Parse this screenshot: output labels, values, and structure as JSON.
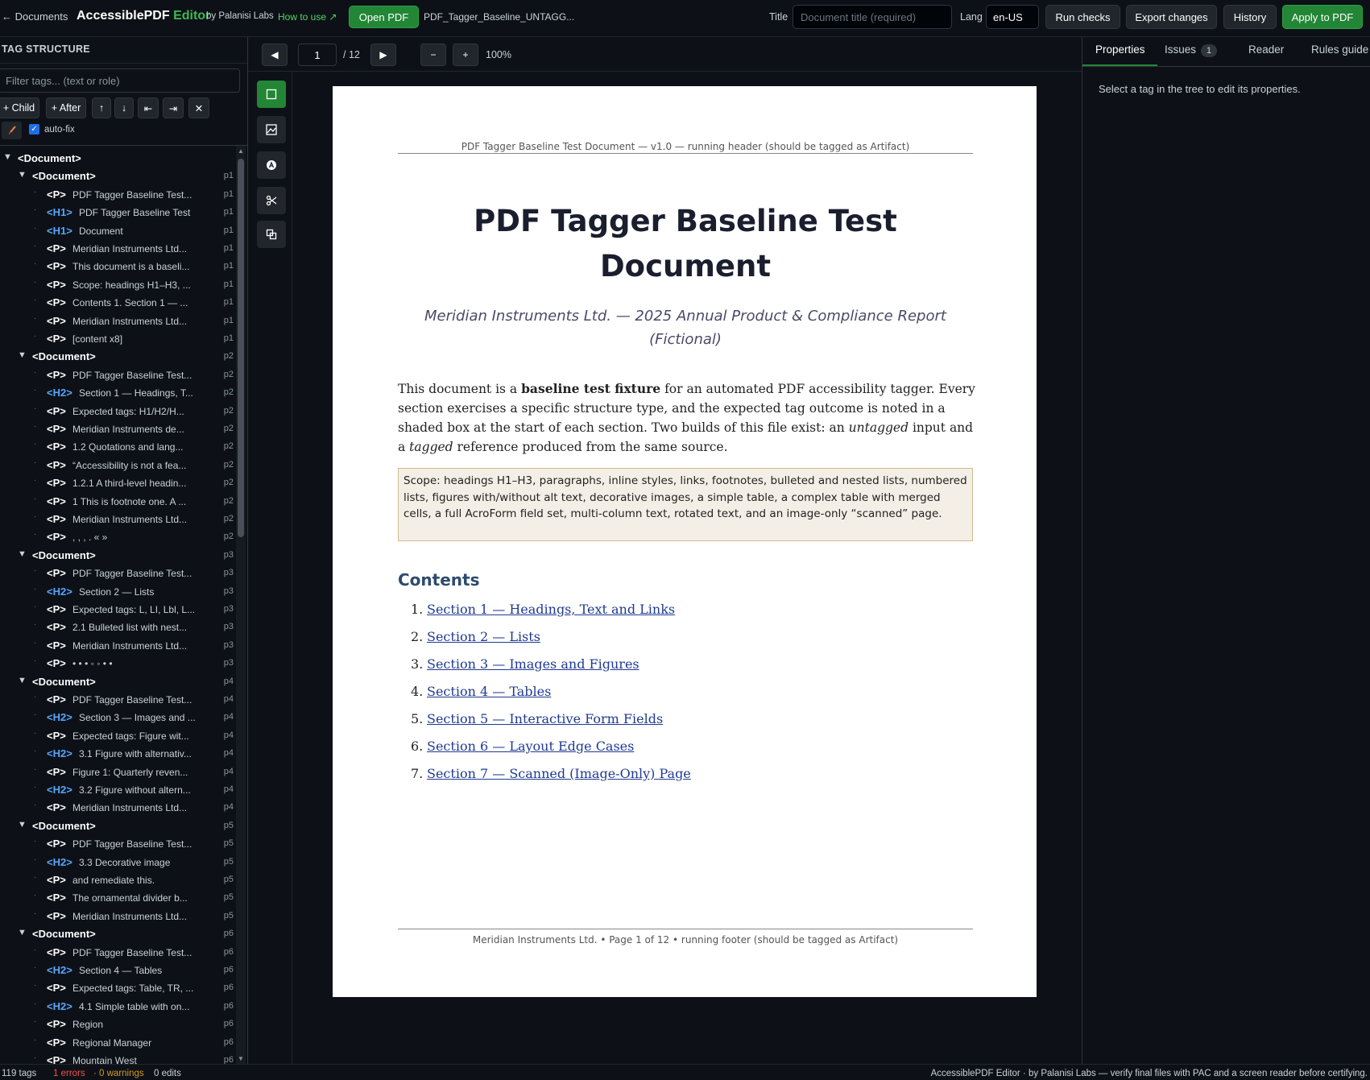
{
  "topbar": {
    "back_label": "← Documents",
    "brand_main": "AccessiblePDF ",
    "brand_accent": "Editor",
    "byline": "by Palanisi Labs",
    "howto": "How to use ↗",
    "open_pdf": "Open PDF",
    "filename": "PDF_Tagger_Baseline_UNTAGG...",
    "title_label": "Title",
    "title_placeholder": "Document title (required)",
    "lang_label": "Lang",
    "lang_value": "en-US",
    "run_checks": "Run checks",
    "export_changes": "Export changes",
    "history": "History",
    "apply": "Apply to PDF"
  },
  "left": {
    "title": "TAG STRUCTURE",
    "filter_placeholder": "Filter tags... (text or role)",
    "add_child": "+ Child",
    "add_after": "+ After",
    "move_up": "↑",
    "move_down": "↓",
    "outdent": "⇤",
    "indent": "⇥",
    "delete": "✕",
    "autofix": "auto-fix",
    "tree": [
      {
        "d": 0,
        "tag": "<Document>",
        "label": "",
        "page": "",
        "kind": "doc"
      },
      {
        "d": 1,
        "tag": "<Document>",
        "label": "",
        "page": "p1",
        "kind": "doc"
      },
      {
        "d": 2,
        "tag": "<P>",
        "label": "PDF Tagger Baseline Test...",
        "page": "p1",
        "kind": "p"
      },
      {
        "d": 2,
        "tag": "<H1>",
        "label": "PDF Tagger Baseline Test",
        "page": "p1",
        "kind": "h"
      },
      {
        "d": 2,
        "tag": "<H1>",
        "label": "Document",
        "page": "p1",
        "kind": "h"
      },
      {
        "d": 2,
        "tag": "<P>",
        "label": "Meridian Instruments Ltd...",
        "page": "p1",
        "kind": "p"
      },
      {
        "d": 2,
        "tag": "<P>",
        "label": "This document is a baseli...",
        "page": "p1",
        "kind": "p"
      },
      {
        "d": 2,
        "tag": "<P>",
        "label": "Scope: headings H1–H3, ...",
        "page": "p1",
        "kind": "p"
      },
      {
        "d": 2,
        "tag": "<P>",
        "label": "Contents 1. Section 1 — ...",
        "page": "p1",
        "kind": "p"
      },
      {
        "d": 2,
        "tag": "<P>",
        "label": "Meridian Instruments Ltd...",
        "page": "p1",
        "kind": "p"
      },
      {
        "d": 2,
        "tag": "<P>",
        "label": "[content x8]",
        "page": "p1",
        "kind": "p"
      },
      {
        "d": 1,
        "tag": "<Document>",
        "label": "",
        "page": "p2",
        "kind": "doc"
      },
      {
        "d": 2,
        "tag": "<P>",
        "label": "PDF Tagger Baseline Test...",
        "page": "p2",
        "kind": "p"
      },
      {
        "d": 2,
        "tag": "<H2>",
        "label": "Section 1 — Headings, T...",
        "page": "p2",
        "kind": "h"
      },
      {
        "d": 2,
        "tag": "<P>",
        "label": "Expected tags: H1/H2/H...",
        "page": "p2",
        "kind": "p"
      },
      {
        "d": 2,
        "tag": "<P>",
        "label": "Meridian Instruments de...",
        "page": "p2",
        "kind": "p"
      },
      {
        "d": 2,
        "tag": "<P>",
        "label": "1.2 Quotations and lang...",
        "page": "p2",
        "kind": "p"
      },
      {
        "d": 2,
        "tag": "<P>",
        "label": "“Accessibility is not a fea...",
        "page": "p2",
        "kind": "p"
      },
      {
        "d": 2,
        "tag": "<P>",
        "label": "1.2.1 A third-level headin...",
        "page": "p2",
        "kind": "p"
      },
      {
        "d": 2,
        "tag": "<P>",
        "label": "1 This is footnote one. A ...",
        "page": "p2",
        "kind": "p"
      },
      {
        "d": 2,
        "tag": "<P>",
        "label": "Meridian Instruments Ltd...",
        "page": "p2",
        "kind": "p"
      },
      {
        "d": 2,
        "tag": "<P>",
        "label": ", , , . « »",
        "page": "p2",
        "kind": "p"
      },
      {
        "d": 1,
        "tag": "<Document>",
        "label": "",
        "page": "p3",
        "kind": "doc"
      },
      {
        "d": 2,
        "tag": "<P>",
        "label": "PDF Tagger Baseline Test...",
        "page": "p3",
        "kind": "p"
      },
      {
        "d": 2,
        "tag": "<H2>",
        "label": "Section 2 — Lists",
        "page": "p3",
        "kind": "h"
      },
      {
        "d": 2,
        "tag": "<P>",
        "label": "Expected tags: L, LI, Lbl, L...",
        "page": "p3",
        "kind": "p"
      },
      {
        "d": 2,
        "tag": "<P>",
        "label": "2.1 Bulleted list with nest...",
        "page": "p3",
        "kind": "p"
      },
      {
        "d": 2,
        "tag": "<P>",
        "label": "Meridian Instruments Ltd...",
        "page": "p3",
        "kind": "p"
      },
      {
        "d": 2,
        "tag": "<P>",
        "label": "• • • ◦ ◦ • •",
        "page": "p3",
        "kind": "p"
      },
      {
        "d": 1,
        "tag": "<Document>",
        "label": "",
        "page": "p4",
        "kind": "doc"
      },
      {
        "d": 2,
        "tag": "<P>",
        "label": "PDF Tagger Baseline Test...",
        "page": "p4",
        "kind": "p"
      },
      {
        "d": 2,
        "tag": "<H2>",
        "label": "Section 3 — Images and ...",
        "page": "p4",
        "kind": "h"
      },
      {
        "d": 2,
        "tag": "<P>",
        "label": "Expected tags: Figure wit...",
        "page": "p4",
        "kind": "p"
      },
      {
        "d": 2,
        "tag": "<H2>",
        "label": "3.1 Figure with alternativ...",
        "page": "p4",
        "kind": "h"
      },
      {
        "d": 2,
        "tag": "<P>",
        "label": "Figure 1: Quarterly reven...",
        "page": "p4",
        "kind": "p"
      },
      {
        "d": 2,
        "tag": "<H2>",
        "label": "3.2 Figure without altern...",
        "page": "p4",
        "kind": "h"
      },
      {
        "d": 2,
        "tag": "<P>",
        "label": "Meridian Instruments Ltd...",
        "page": "p4",
        "kind": "p"
      },
      {
        "d": 1,
        "tag": "<Document>",
        "label": "",
        "page": "p5",
        "kind": "doc"
      },
      {
        "d": 2,
        "tag": "<P>",
        "label": "PDF Tagger Baseline Test...",
        "page": "p5",
        "kind": "p"
      },
      {
        "d": 2,
        "tag": "<H2>",
        "label": "3.3 Decorative image",
        "page": "p5",
        "kind": "h"
      },
      {
        "d": 2,
        "tag": "<P>",
        "label": "and remediate this.",
        "page": "p5",
        "kind": "p"
      },
      {
        "d": 2,
        "tag": "<P>",
        "label": "The ornamental divider b...",
        "page": "p5",
        "kind": "p"
      },
      {
        "d": 2,
        "tag": "<P>",
        "label": "Meridian Instruments Ltd...",
        "page": "p5",
        "kind": "p"
      },
      {
        "d": 1,
        "tag": "<Document>",
        "label": "",
        "page": "p6",
        "kind": "doc"
      },
      {
        "d": 2,
        "tag": "<P>",
        "label": "PDF Tagger Baseline Test...",
        "page": "p6",
        "kind": "p"
      },
      {
        "d": 2,
        "tag": "<H2>",
        "label": "Section 4 — Tables",
        "page": "p6",
        "kind": "h"
      },
      {
        "d": 2,
        "tag": "<P>",
        "label": "Expected tags: Table, TR, ...",
        "page": "p6",
        "kind": "p"
      },
      {
        "d": 2,
        "tag": "<H2>",
        "label": "4.1 Simple table with on...",
        "page": "p6",
        "kind": "h"
      },
      {
        "d": 2,
        "tag": "<P>",
        "label": "Region",
        "page": "p6",
        "kind": "p"
      },
      {
        "d": 2,
        "tag": "<P>",
        "label": "Regional Manager",
        "page": "p6",
        "kind": "p"
      },
      {
        "d": 2,
        "tag": "<P>",
        "label": "Mountain West",
        "page": "p6",
        "kind": "p"
      }
    ]
  },
  "viewer": {
    "prev": "◀",
    "next": "▶",
    "page": "1",
    "page_total": "/ 12",
    "zoom_out": "−",
    "zoom_in": "+",
    "zoom": "100%"
  },
  "pdf": {
    "header": "PDF Tagger Baseline Test Document — v1.0 — running header (should be tagged as Artifact)",
    "title_line1": "PDF Tagger Baseline Test",
    "title_line2": "Document",
    "subtitle_line1": "Meridian Instruments Ltd. — 2025 Annual Product & Compliance Report",
    "subtitle_line2": "(Fictional)",
    "intro_1": "This document is a ",
    "intro_bold": "baseline test fixture",
    "intro_2": " for an automated PDF accessibility tagger. Every section exercises a specific structure type, and the expected tag outcome is noted in a shaded box at the start of each section. Two builds of this file exist: an ",
    "intro_it1": "untagged",
    "intro_3": " input and a ",
    "intro_it2": "tagged",
    "intro_4": " reference produced from the same source.",
    "scope": "Scope: headings H1–H3, paragraphs, inline styles, links, footnotes, bulleted and nested lists, numbered lists, figures with/without alt text, decorative images, a simple table, a complex table with merged cells, a full AcroForm field set, multi-column text, rotated text, and an image-only “scanned” page.",
    "contents_heading": "Contents",
    "toc": [
      {
        "num": "1.",
        "text": "Section 1 — Headings, Text and Links"
      },
      {
        "num": "2.",
        "text": "Section 2 — Lists"
      },
      {
        "num": "3.",
        "text": "Section 3 — Images and Figures"
      },
      {
        "num": "4.",
        "text": "Section 4 — Tables"
      },
      {
        "num": "5.",
        "text": "Section 5 — Interactive Form Fields"
      },
      {
        "num": "6.",
        "text": "Section 6 — Layout Edge Cases"
      },
      {
        "num": "7.",
        "text": "Section 7 — Scanned (Image-Only) Page"
      }
    ],
    "footer": "Meridian Instruments Ltd. • Page 1 of 12 • running footer (should be tagged as Artifact)"
  },
  "right": {
    "tab_properties": "Properties",
    "tab_issues": "Issues",
    "issues_count": "1",
    "tab_reader": "Reader",
    "tab_rules": "Rules guide",
    "hint": "Select a tag in the tree to edit its properties."
  },
  "status": {
    "tags": "119 tags",
    "errors": "1 errors",
    "warnings": "· 0 warnings",
    "edits": "0 edits",
    "footer": "AccessiblePDF Editor · by Palanisi Labs — verify final files with PAC and a screen reader before certifying."
  },
  "colors": {
    "accent_green": "#238636",
    "heading_tag_blue": "#58a6ff",
    "link_blue": "#1f3a93",
    "error_red": "#f85149",
    "warning_amber": "#d29922"
  }
}
